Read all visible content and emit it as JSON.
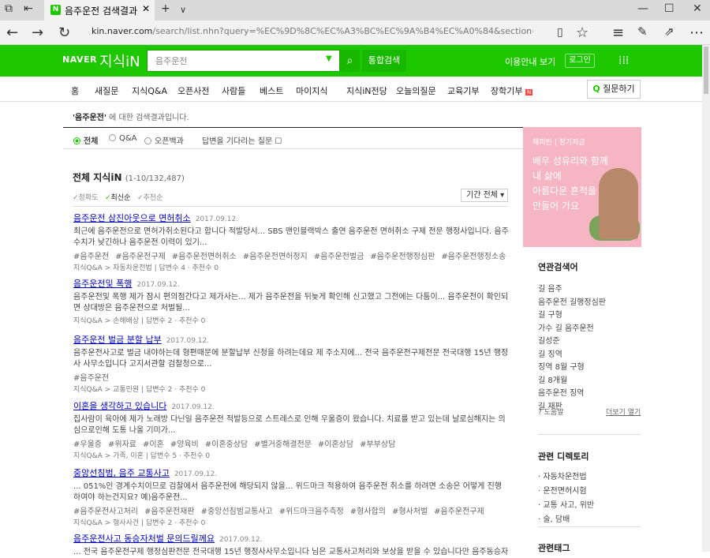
{
  "browser": {
    "tab_title": "음주운전 검색결과 : 지식",
    "favicon": "N",
    "url_prefix": "kin.naver.com",
    "url_rest": "/search/list.nhn?query=%EC%9D%8C%EC%A3%BC%EC%9A%B4%EC%A0%84&section=kin&sort=date"
  },
  "header": {
    "logo": "NAVER",
    "service": "지식iN",
    "search_value": "음주운전",
    "total_button": "통합검색",
    "guide": "이용안내 보기",
    "login": "로그인"
  },
  "gnb": {
    "items": [
      "홈",
      "새질문",
      "지식Q&A",
      "오픈사전",
      "사람들",
      "베스트",
      "마이지식",
      "지식iN전당",
      "오늘의질문",
      "교육기부",
      "장학기부"
    ],
    "new_badge": "N",
    "ask_button": "질문하기"
  },
  "notice": {
    "query": "'음주운전'",
    "suffix": " 에 대한 검색결과입니다."
  },
  "filters": [
    "전체",
    "Q&A",
    "오픈백과",
    "답변을 기다리는 질문"
  ],
  "section": {
    "title": "전체 지식iN",
    "count": "(1-10/132,487)"
  },
  "sorts": [
    "정확도",
    "최신순",
    "추천순"
  ],
  "period": "기간 전체",
  "results": [
    {
      "title": "음주운전 삼진아웃으로 면허취소",
      "date": "2017.09.12.",
      "desc": "최근에 음주운전으로 면허가취소된다고 합니다 적발당시... SBS 맨인블랙박스 출연 음주운전 면허취소 구제 전문 행정사입니다. 음주수치가 낮긴하나 음주운전 이력이 있기...",
      "tags": [
        "#음주운전",
        "#음주운전구제",
        "#음주운전면허취소",
        "#음주운전면허정지",
        "#음주운전벌금",
        "#음주운전행정심판",
        "#음주운전행정소송"
      ],
      "meta": "지식Q&A > 자동차운전법 | 답변수 4 · 추천수 0"
    },
    {
      "title": "음주운전및 폭행",
      "date": "2017.09.12.",
      "desc": "음주운전및 폭행 제가 잠시 편의점간다고 제가사는... 제가 음주운전을 뒤늦게 확인해 신고했고 그전에는 다툼이... 음주운전이 확인되면 상대방은 음주운전으로 처벌될...",
      "tags": [],
      "meta": "지식Q&A > 손해배상 | 답변수 2 · 추천수 0"
    },
    {
      "title": "음주운전 벌금 분할 납부",
      "date": "2017.09.12.",
      "desc": "음주운전사고로 벌금 내야하는데 형편때문에 분할납부 신청을 하려는데요 제 주소지에... 전국 음주운전구제전문 전국대행 15년 행정사 사무소입니다 고지서관할 검찰청으로...",
      "tags": [
        "#음주운전"
      ],
      "meta": "지식Q&A > 교통민원 | 답변수 2 · 추천수 0"
    },
    {
      "title": "이혼을 생각하고 있습니다",
      "date": "2017.09.12.",
      "desc": "집사람이 육아에 제가 노래방 다닌일 음주운전 적발등으로 스트레스로 인해 우울증이 왔습니다. 치료를 받고 있는데 날로심해지는 의심으로인해 도통 나올 기미가...",
      "tags": [
        "#우울증",
        "#위자료",
        "#이혼",
        "#양육비",
        "#이혼중상담",
        "#별거중해결전문",
        "#이혼상담",
        "#부부상담"
      ],
      "meta": "지식Q&A > 가족, 이혼 | 답변수 5 · 추천수 0"
    },
    {
      "title": "중앙선침범, 음주 교통사고",
      "date": "2017.09.12.",
      "desc": "... 051%인 경계수치이므로 검찰에서 음주운전에 해당되지 않을... 위드마크 적용하여 음주운전 취소를 하려면 소송은 어떻게 진행하여야 하는건지요? 예)음주운전...",
      "tags": [
        "#음주운전사고처리",
        "#음주운전재판",
        "#중앙선침범교통사고",
        "#위드마크음주측정",
        "#형사합의",
        "#형사처벌",
        "#음주운전구제"
      ],
      "meta": "지식Q&A > 형사사건 | 답변수 2 · 추천수 0"
    },
    {
      "title": "음주운전사고 동승자처벌 문의드릴께요",
      "date": "2017.09.12.",
      "desc": "... 전국 음주운전구제 행정심판전문 전국대행 15년 행정사사무소입니다 님은 교통사고처리와 보상을 받을 수 있습니다만 음주동승자 처",
      "tags": [],
      "meta": ""
    }
  ],
  "ad": {
    "head": "해피빈 | 정기저금",
    "text": [
      "배우 성유리와 함께",
      "내 삶에",
      "아름다운 흔적을",
      "만들어 가요"
    ]
  },
  "related": {
    "title": "연관검색어",
    "items": [
      "길 음주",
      "음주운전 길행정심판",
      "길 구형",
      "가수 길 음주운전",
      "길성준",
      "길 징역",
      "징역 8월 구형",
      "길 8개월",
      "음주운전 징역",
      "길 재판"
    ],
    "help": "도움말",
    "more": "더보기 열기"
  },
  "directory": {
    "title": "관련 디렉토리",
    "items": [
      "자동차운전법",
      "운전면허시험",
      "교통 사고, 위반",
      "술, 담배"
    ]
  },
  "tags_title": "관련태그"
}
